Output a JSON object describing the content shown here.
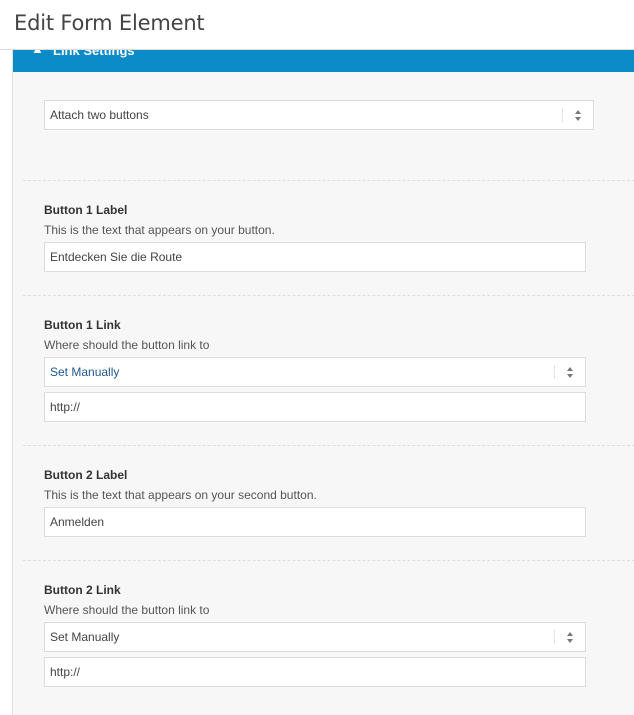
{
  "header": {
    "title": "Edit Form Element"
  },
  "section": {
    "title": "Link Settings",
    "toggle_glyph": "▲"
  },
  "attach": {
    "value": "Attach two buttons"
  },
  "button1_label": {
    "title": "Button 1 Label",
    "description": "This is the text that appears on your button.",
    "value": "Entdecken Sie die Route"
  },
  "button1_link": {
    "title": "Button 1 Link",
    "description": "Where should the button link to",
    "select_value": "Set Manually",
    "url_value": "http://"
  },
  "button2_label": {
    "title": "Button 2 Label",
    "description": "This is the text that appears on your second button.",
    "value": "Anmelden"
  },
  "button2_link": {
    "title": "Button 2 Link",
    "description": "Where should the button link to",
    "select_value": "Set Manually",
    "url_value": "http://"
  },
  "icons": {
    "select_arrows": "updown-arrows-icon"
  },
  "colors": {
    "accent": "#0b8bc7",
    "link_text": "#21598d",
    "panel_bg": "#f7f7f7"
  }
}
